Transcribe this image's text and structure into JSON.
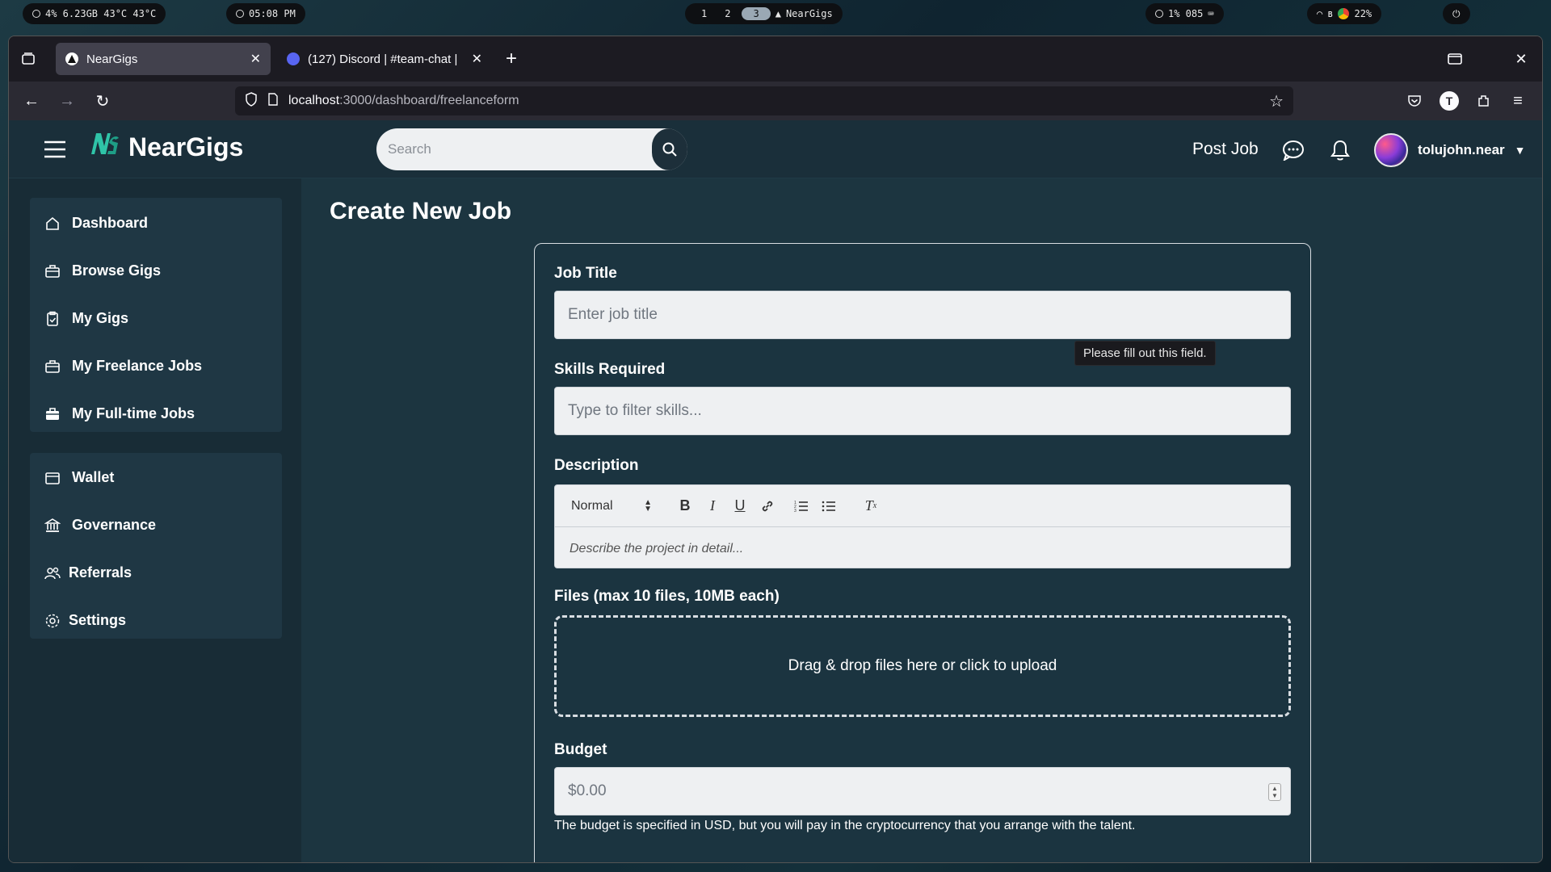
{
  "system_bar": {
    "stats": "4%  6.23GB  43°C  43°C",
    "clock": "05:08 PM",
    "workspaces": [
      "1",
      "2",
      "3"
    ],
    "active_window": "NearGigs",
    "status_right": "1%   085",
    "battery": "22%"
  },
  "browser": {
    "tabs": [
      {
        "title": "NearGigs",
        "favicon": "neargigs-icon"
      },
      {
        "title": "(127) Discord | #team-chat |",
        "favicon": "discord-icon"
      }
    ],
    "url_host": "localhost",
    "url_path": ":3000/dashboard/freelanceform",
    "profile_initial": "T"
  },
  "app": {
    "brand": "NearGigs",
    "search_placeholder": "Search",
    "post_job": "Post Job",
    "username": "tolujohn.near"
  },
  "sidebar": {
    "primary": [
      {
        "label": "Dashboard",
        "icon": "home-icon"
      },
      {
        "label": "Browse Gigs",
        "icon": "briefcase-icon"
      },
      {
        "label": "My Gigs",
        "icon": "clipboard-icon"
      },
      {
        "label": "My Freelance Jobs",
        "icon": "briefcase-icon"
      },
      {
        "label": "My Full-time Jobs",
        "icon": "briefcase-filled-icon"
      }
    ],
    "secondary": [
      {
        "label": "Wallet",
        "icon": "wallet-icon"
      },
      {
        "label": "Governance",
        "icon": "bank-icon"
      },
      {
        "label": "Referrals",
        "icon": "users-icon"
      },
      {
        "label": "Settings",
        "icon": "gear-icon"
      }
    ]
  },
  "form": {
    "page_title": "Create New Job",
    "job_title_label": "Job Title",
    "job_title_placeholder": "Enter job title",
    "tooltip": "Please fill out this field.",
    "skills_label": "Skills Required",
    "skills_placeholder": "Type to filter skills...",
    "description_label": "Description",
    "editor_format": "Normal",
    "description_placeholder": "Describe the project in detail...",
    "files_label": "Files (max 10 files, 10MB each)",
    "dropzone_text": "Drag & drop files here or click to upload",
    "budget_label": "Budget",
    "budget_placeholder": "$0.00",
    "budget_hint": "The budget is specified in USD, but you will pay in the cryptocurrency that you arrange with the talent."
  },
  "colors": {
    "app_bg": "#1c3540",
    "sidebar_bg": "#182c36",
    "input_bg": "#eef0f2",
    "brand_accent": "#2fc4a8"
  }
}
